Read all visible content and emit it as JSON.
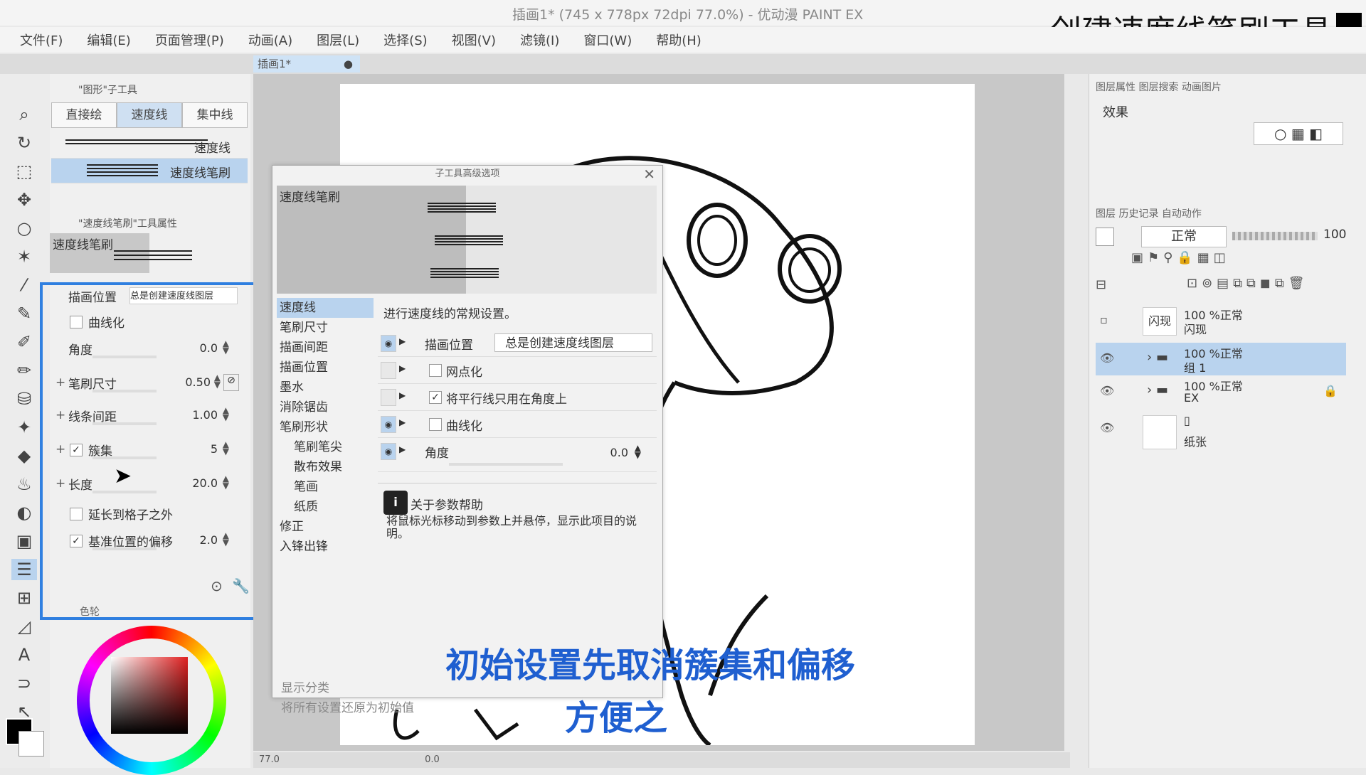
{
  "window": {
    "title": "插画1* (745 x 778px 72dpi 77.0%) - 优动漫 PAINT EX"
  },
  "overlay": {
    "title": "创建速度线笔刷工具"
  },
  "menu": [
    "文件(F)",
    "编辑(E)",
    "页面管理(P)",
    "动画(A)",
    "图层(L)",
    "选择(S)",
    "视图(V)",
    "滤镜(I)",
    "窗口(W)",
    "帮助(H)"
  ],
  "doc_tab": {
    "label": "插画1*"
  },
  "subtool": {
    "header": "\"图形\"子工具",
    "tabs": [
      "直接绘",
      "速度线",
      "集中线"
    ],
    "brushes": [
      {
        "label": "速度线"
      },
      {
        "label": "速度线笔刷"
      }
    ]
  },
  "toolprop": {
    "header": "\"速度线笔刷\"工具属性",
    "name": "速度线笔刷",
    "props": [
      {
        "name": "描画位置",
        "value": "总是创建速度线图层"
      },
      {
        "name": "曲线化",
        "checked": false
      },
      {
        "name": "角度",
        "value": "0.0"
      },
      {
        "name": "笔刷尺寸",
        "value": "0.50"
      },
      {
        "name": "线条间距",
        "value": "1.00"
      },
      {
        "name": "簇集",
        "value": "5",
        "checked": true
      },
      {
        "name": "长度",
        "value": "20.0"
      },
      {
        "name": "延长到格子之外",
        "checked": false
      },
      {
        "name": "基准位置的偏移",
        "value": "2.0",
        "checked": true
      }
    ],
    "color_panel": "色轮"
  },
  "dialog": {
    "title": "子工具高级选项",
    "preview_label": "速度线笔刷",
    "categories": [
      {
        "label": "速度线",
        "sub": false
      },
      {
        "label": "笔刷尺寸",
        "sub": false
      },
      {
        "label": "描画间距",
        "sub": false
      },
      {
        "label": "描画位置",
        "sub": false
      },
      {
        "label": "墨水",
        "sub": false
      },
      {
        "label": "消除锯齿",
        "sub": false
      },
      {
        "label": "笔刷形状",
        "sub": false
      },
      {
        "label": "笔刷笔尖",
        "sub": true
      },
      {
        "label": "散布效果",
        "sub": true
      },
      {
        "label": "笔画",
        "sub": true
      },
      {
        "label": "纸质",
        "sub": true
      },
      {
        "label": "修正",
        "sub": false
      },
      {
        "label": "入锋出锋",
        "sub": false
      }
    ],
    "description": "进行速度线的常规设置。",
    "rows": {
      "draw_pos_label": "描画位置",
      "draw_pos_value": "总是创建速度线图层",
      "halftone": "网点化",
      "parallel": "将平行线只用在角度上",
      "curve": "曲线化",
      "angle_label": "角度",
      "angle_value": "0.0"
    },
    "help_title": "关于参数帮助",
    "help_text": "将鼠标光标移动到参数上并悬停，显示此项目的说明。",
    "show_category": "显示分类",
    "reset": "将所有设置还原为初始值"
  },
  "right": {
    "layerprop_tabs": "图层属性  图层搜索  动画图片",
    "effect_label": "效果",
    "layer_tabs": "图层  历史记录  自动动作",
    "blend": "正常",
    "opacity": "100",
    "layers": [
      {
        "l1": "100 %正常",
        "l2": "闪现",
        "thumb": "闪现",
        "type": "text",
        "active": false
      },
      {
        "l1": "100 %正常",
        "l2": "组 1",
        "type": "folder",
        "active": true
      },
      {
        "l1": "100 %正常",
        "l2": "EX",
        "type": "folder",
        "active": false,
        "locked": true
      },
      {
        "l1": "",
        "l2": "纸张",
        "type": "paper",
        "active": false
      }
    ]
  },
  "status": {
    "zoom": "77.0",
    "angle": "0.0"
  },
  "subtitles": {
    "line1": "初始设置先取消簇集和偏移",
    "line2": "方便之"
  }
}
